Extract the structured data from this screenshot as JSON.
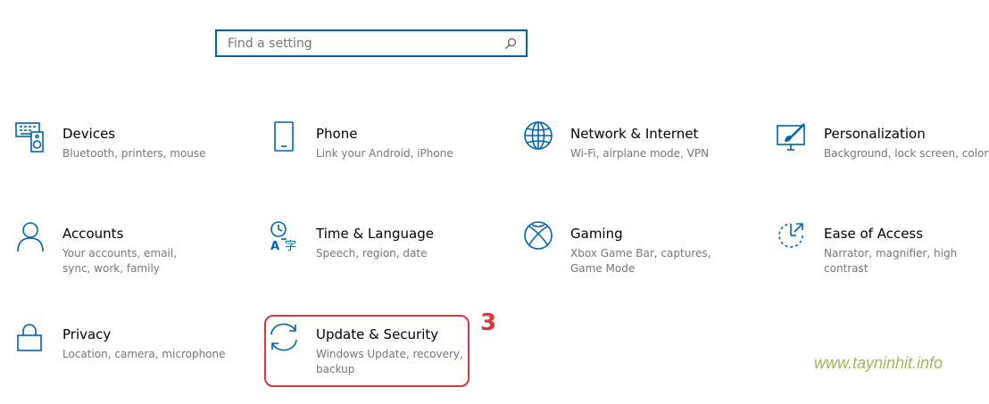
{
  "search": {
    "placeholder": "Find a setting",
    "icon": "search-icon"
  },
  "accent_color": "#0063b1",
  "tiles": [
    {
      "title": "Devices",
      "desc": "Bluetooth, printers, mouse",
      "icon": "devices-icon"
    },
    {
      "title": "Phone",
      "desc": "Link your Android, iPhone",
      "icon": "phone-icon"
    },
    {
      "title": "Network & Internet",
      "desc": "Wi-Fi, airplane mode, VPN",
      "icon": "globe-icon"
    },
    {
      "title": "Personalization",
      "desc": "Background, lock screen, colors",
      "icon": "paintbrush-icon"
    },
    {
      "title": "Accounts",
      "desc": "Your accounts, email, sync, work, family",
      "icon": "person-icon"
    },
    {
      "title": "Time & Language",
      "desc": "Speech, region, date",
      "icon": "time-language-icon"
    },
    {
      "title": "Gaming",
      "desc": "Xbox Game Bar, captures, Game Mode",
      "icon": "xbox-icon"
    },
    {
      "title": "Ease of Access",
      "desc": "Narrator, magnifier, high contrast",
      "icon": "ease-of-access-icon"
    },
    {
      "title": "Privacy",
      "desc": "Location, camera, microphone",
      "icon": "lock-icon"
    },
    {
      "title": "Update & Security",
      "desc": "Windows Update, recovery, backup",
      "icon": "sync-icon"
    }
  ],
  "annotation": {
    "step_number": "3",
    "highlight_color": "#e0343c"
  },
  "watermark": "www.tayninhit.info"
}
